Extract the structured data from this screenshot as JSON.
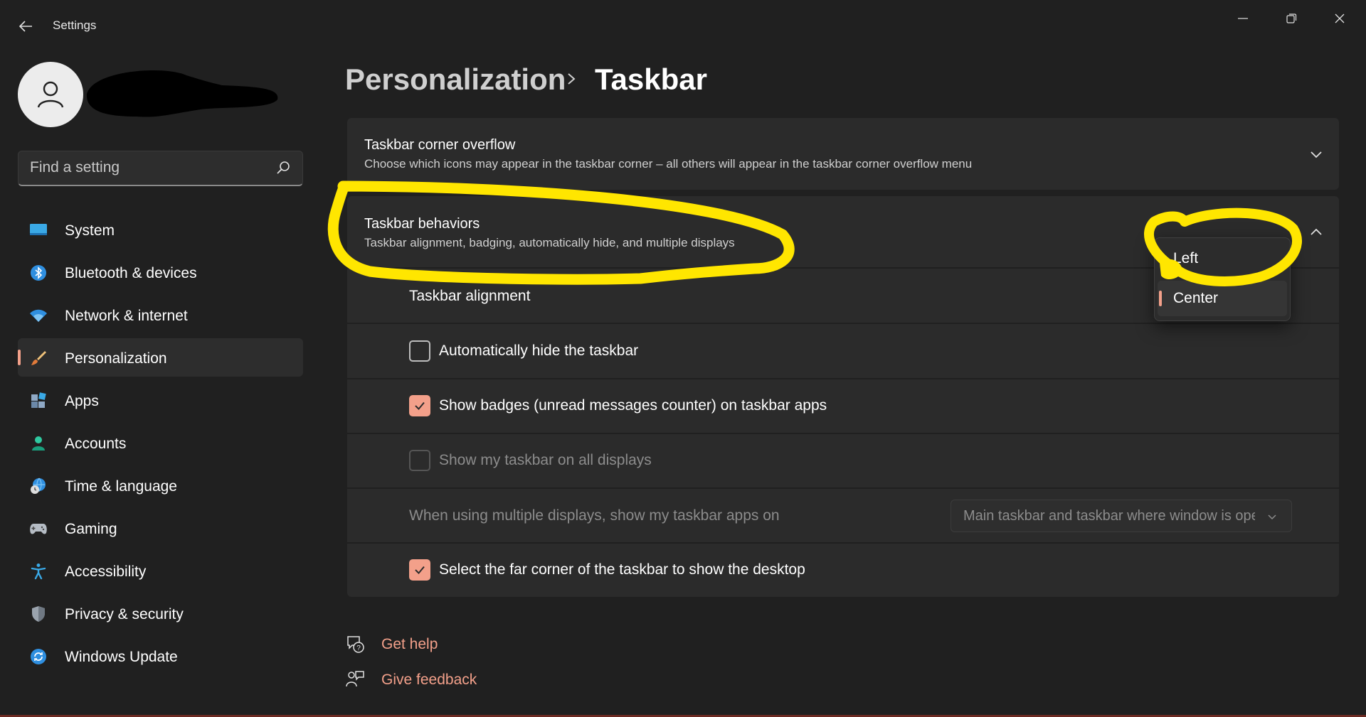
{
  "window": {
    "title": "Settings"
  },
  "sidebar": {
    "search_placeholder": "Find a setting",
    "items": [
      {
        "label": "System",
        "icon": "system-icon"
      },
      {
        "label": "Bluetooth & devices",
        "icon": "bluetooth-icon"
      },
      {
        "label": "Network & internet",
        "icon": "wifi-icon"
      },
      {
        "label": "Personalization",
        "icon": "brush-icon",
        "active": true
      },
      {
        "label": "Apps",
        "icon": "apps-icon"
      },
      {
        "label": "Accounts",
        "icon": "person-icon"
      },
      {
        "label": "Time & language",
        "icon": "globe-clock-icon"
      },
      {
        "label": "Gaming",
        "icon": "gamepad-icon"
      },
      {
        "label": "Accessibility",
        "icon": "accessibility-icon"
      },
      {
        "label": "Privacy & security",
        "icon": "shield-icon"
      },
      {
        "label": "Windows Update",
        "icon": "update-icon"
      }
    ]
  },
  "breadcrumb": {
    "parent": "Personalization",
    "current": "Taskbar"
  },
  "sections": {
    "overflow": {
      "title": "Taskbar corner overflow",
      "description": "Choose which icons may appear in the taskbar corner – all others will appear in the taskbar corner overflow menu",
      "expanded": false
    },
    "behaviors": {
      "title": "Taskbar behaviors",
      "description": "Taskbar alignment, badging, automatically hide, and multiple displays",
      "expanded": true,
      "alignment_label": "Taskbar alignment",
      "alignment_options": [
        "Left",
        "Center"
      ],
      "alignment_selected": "Center",
      "auto_hide": {
        "label": "Automatically hide the taskbar",
        "checked": false,
        "disabled": false
      },
      "badges": {
        "label": "Show badges (unread messages counter) on taskbar apps",
        "checked": true,
        "disabled": false
      },
      "all_displays": {
        "label": "Show my taskbar on all displays",
        "checked": false,
        "disabled": true
      },
      "multi_display": {
        "label": "When using multiple displays, show my taskbar apps on",
        "value": "Main taskbar and taskbar where window is open",
        "disabled": true
      },
      "far_corner": {
        "label": "Select the far corner of the taskbar to show the desktop",
        "checked": true,
        "disabled": false
      }
    }
  },
  "footer": {
    "help": "Get help",
    "feedback": "Give feedback"
  },
  "colors": {
    "accent": "#f3a08a",
    "background": "#202020",
    "card": "#2b2b2b",
    "annotation": "#ffe600"
  }
}
